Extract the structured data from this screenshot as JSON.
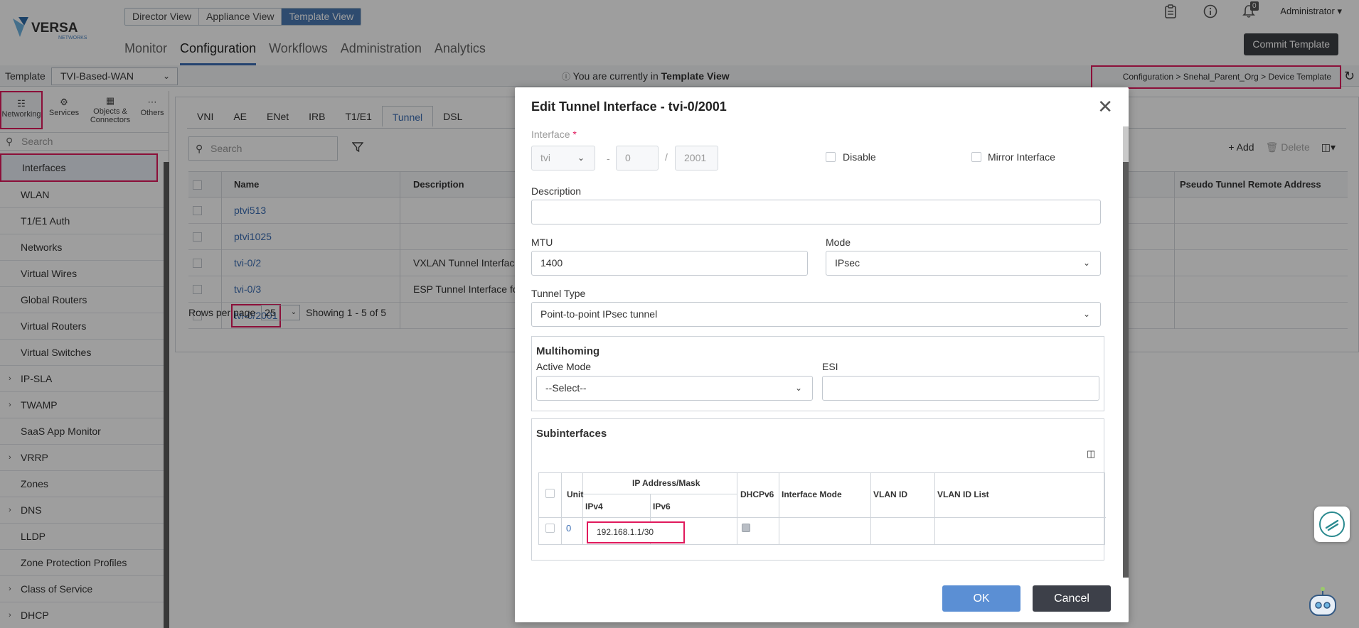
{
  "header": {
    "logo_text": "VERSA",
    "logo_sub": "NETWORKS",
    "views": [
      "Director View",
      "Appliance View",
      "Template View"
    ],
    "active_view": "Template View",
    "nav": [
      "Monitor",
      "Configuration",
      "Workflows",
      "Administration",
      "Analytics"
    ],
    "active_nav": "Configuration",
    "notification_count": "0",
    "user": "Administrator ▾",
    "commit_label": "Commit Template"
  },
  "template_bar": {
    "label": "Template",
    "selected": "TVI-Based-WAN",
    "message_prefix": "You are currently in ",
    "message_bold": "Template View",
    "breadcrumb": "Configuration  >  Snehal_Parent_Org  >  Device Template"
  },
  "sidebar": {
    "tabs": [
      {
        "label": "Networking",
        "icon": "network-icon"
      },
      {
        "label": "Services",
        "icon": "services-icon"
      },
      {
        "label": "Objects & Connectors",
        "icon": "objects-icon"
      },
      {
        "label": "Others",
        "icon": "more-icon"
      }
    ],
    "search_placeholder": "Search",
    "items": [
      {
        "label": "Interfaces",
        "expandable": false
      },
      {
        "label": "WLAN",
        "expandable": false
      },
      {
        "label": "T1/E1 Auth",
        "expandable": false
      },
      {
        "label": "Networks",
        "expandable": false
      },
      {
        "label": "Virtual Wires",
        "expandable": false
      },
      {
        "label": "Global Routers",
        "expandable": false
      },
      {
        "label": "Virtual Routers",
        "expandable": false
      },
      {
        "label": "Virtual Switches",
        "expandable": false
      },
      {
        "label": "IP-SLA",
        "expandable": true
      },
      {
        "label": "TWAMP",
        "expandable": true
      },
      {
        "label": "SaaS App Monitor",
        "expandable": false
      },
      {
        "label": "VRRP",
        "expandable": true
      },
      {
        "label": "Zones",
        "expandable": false
      },
      {
        "label": "DNS",
        "expandable": true
      },
      {
        "label": "LLDP",
        "expandable": false
      },
      {
        "label": "Zone Protection Profiles",
        "expandable": false
      },
      {
        "label": "Class of Service",
        "expandable": true
      },
      {
        "label": "DHCP",
        "expandable": true
      }
    ]
  },
  "content": {
    "tabs": [
      "VNI",
      "AE",
      "ENet",
      "IRB",
      "T1/E1",
      "Tunnel",
      "DSL"
    ],
    "active_tab": "Tunnel",
    "search_placeholder": "Search",
    "add_label": "+ Add",
    "delete_label": "Delete",
    "columns": {
      "name": "Name",
      "description": "Description",
      "pseudo": "Pseudo Tunnel Remote Address"
    },
    "rows": [
      {
        "name": "ptvi513",
        "description": ""
      },
      {
        "name": "ptvi1025",
        "description": ""
      },
      {
        "name": "tvi-0/2",
        "description": "VXLAN Tunnel Interface fo"
      },
      {
        "name": "tvi-0/3",
        "description": "ESP Tunnel Interface for S"
      },
      {
        "name": "tvi-0/2001",
        "description": ""
      }
    ],
    "rows_per_page_label": "Rows per page",
    "rows_per_page": "25",
    "showing": "Showing  1  -  5  of  5"
  },
  "modal": {
    "title": "Edit Tunnel Interface - tvi-0/2001",
    "interface_label": "Interface",
    "interface_type": "tvi",
    "interface_sep1": "-",
    "interface_slot": "0",
    "interface_sep2": "/",
    "interface_port": "2001",
    "disable_label": "Disable",
    "mirror_label": "Mirror Interface",
    "description_label": "Description",
    "description_value": "",
    "mtu_label": "MTU",
    "mtu_value": "1400",
    "mode_label": "Mode",
    "mode_value": "IPsec",
    "tunnel_type_label": "Tunnel Type",
    "tunnel_type_value": "Point-to-point IPsec tunnel",
    "multihoming_title": "Multihoming",
    "active_mode_label": "Active Mode",
    "active_mode_value": "--Select--",
    "esi_label": "ESI",
    "esi_value": "",
    "subinterfaces_title": "Subinterfaces",
    "sub_columns": {
      "unit": "Unit",
      "ip": "IP Address/Mask",
      "ipv4": "IPv4",
      "ipv6": "IPv6",
      "dhcpv6": "DHCPv6",
      "mode": "Interface Mode",
      "vlan_id": "VLAN ID",
      "vlan_list": "VLAN ID List"
    },
    "sub_row": {
      "unit": "0",
      "ipv4": "192.168.1.1/30",
      "ipv6": ""
    },
    "ok_label": "OK",
    "cancel_label": "Cancel"
  },
  "colors": {
    "accent": "#3a6db3",
    "highlight": "#e0195c",
    "ok": "#5b8fd4",
    "cancel": "#3d4049"
  }
}
